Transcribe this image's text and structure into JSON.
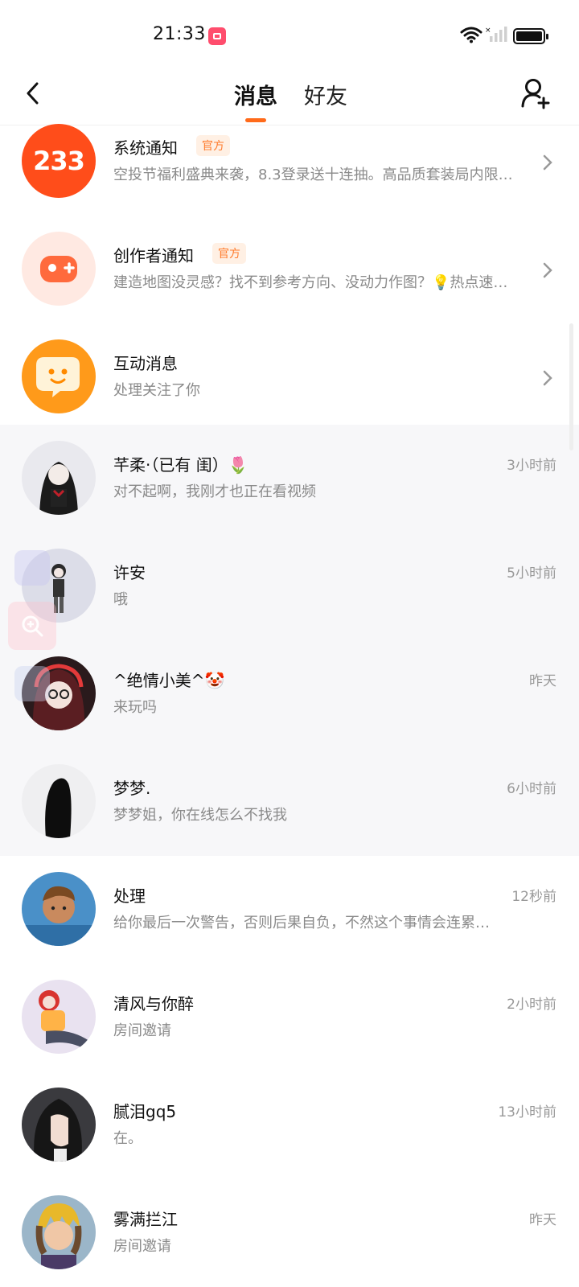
{
  "status_bar": {
    "time": "21:33"
  },
  "header": {
    "tabs": [
      {
        "label": "消息"
      },
      {
        "label": "好友"
      }
    ],
    "accent": "#ff6a1a"
  },
  "system_rows": [
    {
      "title": "系统通知",
      "badge": "官方",
      "preview": "空投节福利盛典来袭，8.3登录送十连抽。高品质套装局内限…",
      "avatar_text": "233",
      "avatar_color": "#ff4d1a"
    },
    {
      "title": "创作者通知",
      "badge": "官方",
      "preview": "建造地图没灵感？找不到参考方向、没动力作图？💡热点速…",
      "avatar_color": "#ffe9e2"
    },
    {
      "title": "互动消息",
      "preview": "处理关注了你",
      "avatar_color": "#ff9a1a"
    }
  ],
  "chats": [
    {
      "name": "芊柔·（已有 闺）🌷",
      "preview": "对不起啊，我刚才也正在看视频",
      "time": "3小时前"
    },
    {
      "name": "许安",
      "preview": "哦",
      "time": "5小时前"
    },
    {
      "name": "^绝情小美^🤡",
      "preview": "来玩吗",
      "time": "昨天"
    },
    {
      "name": "梦梦.",
      "preview": "梦梦姐，你在线怎么不找我",
      "time": "6小时前"
    },
    {
      "name": "处理",
      "preview": "给你最后一次警告，否则后果自负，不然这个事情会连累…",
      "time": "12秒前"
    },
    {
      "name": "清风与你醉",
      "preview": "房间邀请",
      "time": "2小时前"
    },
    {
      "name": "腻泪gq5",
      "preview": "在。",
      "time": "13小时前"
    },
    {
      "name": "雾满拦江",
      "preview": "房间邀请",
      "time": "昨天"
    }
  ]
}
